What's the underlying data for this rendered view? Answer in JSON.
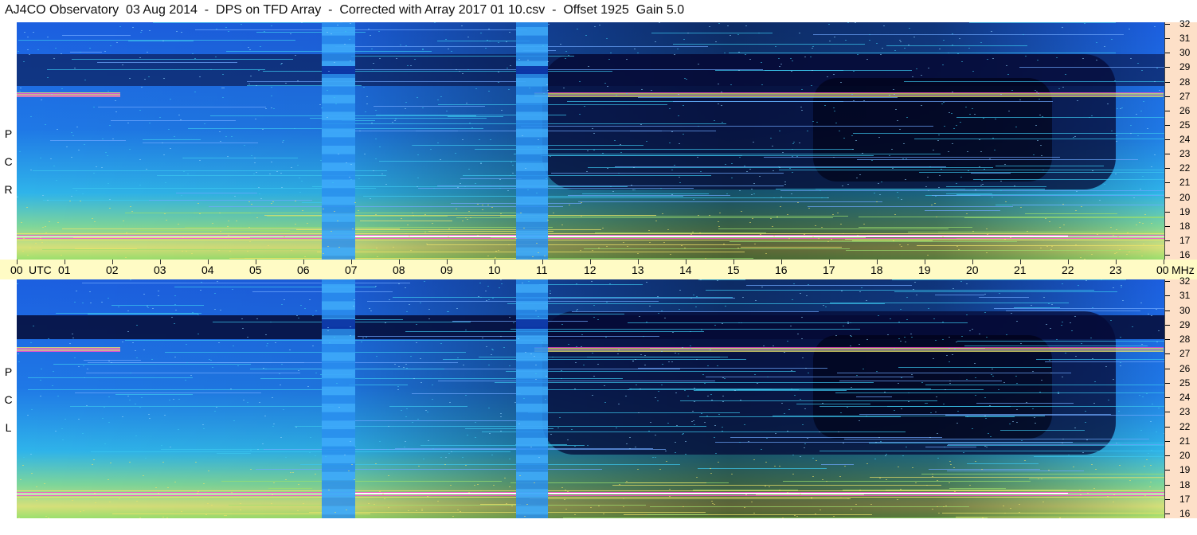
{
  "title": "AJ4CO Observatory  03 Aug 2014  -  DPS on TFD Array  -  Corrected with Array 2017 01 10.csv  -  Offset 1925  Gain 5.0",
  "panels": [
    {
      "id": "rcp",
      "polarization_label": [
        "R",
        "C",
        "P"
      ]
    },
    {
      "id": "lcp",
      "polarization_label": [
        "L",
        "C",
        "P"
      ]
    }
  ],
  "time_axis": {
    "labels": [
      "00",
      "UTC",
      "01",
      "02",
      "03",
      "04",
      "05",
      "06",
      "07",
      "08",
      "09",
      "10",
      "11",
      "12",
      "13",
      "14",
      "15",
      "16",
      "17",
      "18",
      "19",
      "20",
      "21",
      "22",
      "23",
      "00",
      "MHz"
    ]
  },
  "freq_axis": {
    "labels": [
      "32",
      "31",
      "30",
      "29",
      "28",
      "27",
      "26",
      "25",
      "24",
      "23",
      "22",
      "21",
      "20",
      "19",
      "18",
      "17",
      "16"
    ]
  },
  "colors": {
    "background_blue": "#1e6ee0",
    "dark_band": "#050a35",
    "cyan": "#3cc8f0",
    "green": "#9be06e",
    "yellow": "#f0e46a",
    "magenta": "#ff4fd0",
    "axis_yellow": "#fffbc5",
    "freq_panel": "#fde0c8"
  }
}
